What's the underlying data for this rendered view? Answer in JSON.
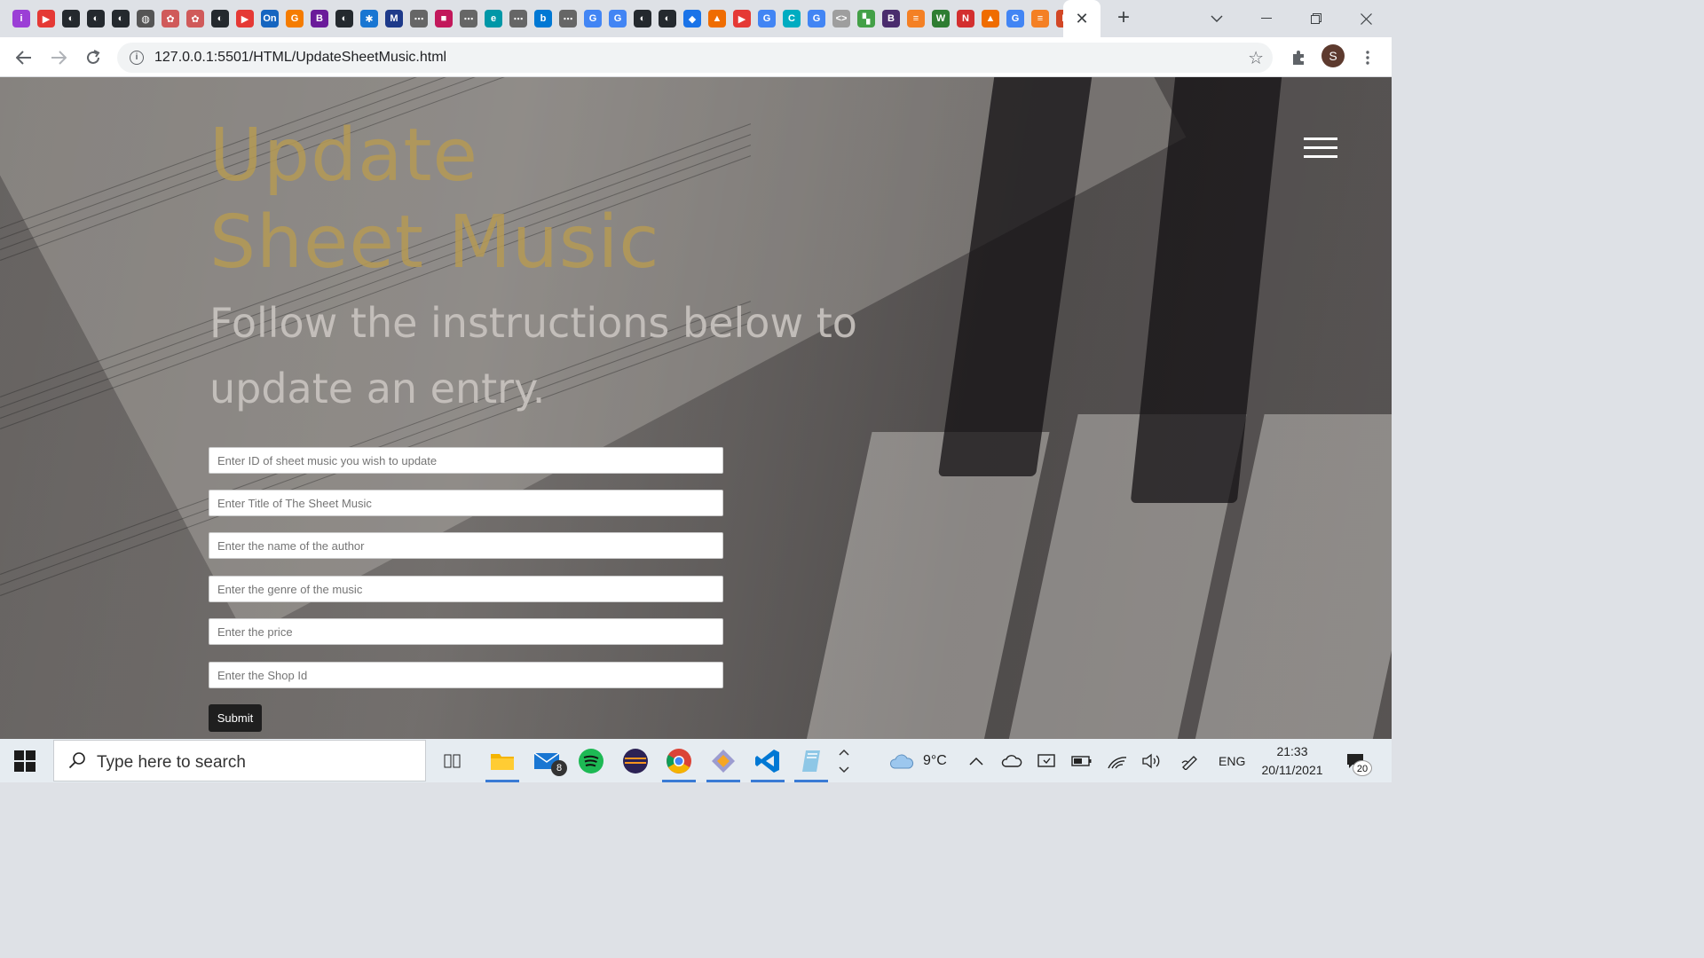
{
  "browser": {
    "url": "127.0.0.1:5501/HTML/UpdateSheetMusic.html",
    "active_tab_close": "✕",
    "new_tab": "+",
    "profile_initial": "S",
    "favicons": [
      {
        "name": "favicon-instagram-icon",
        "color": "#9b3fd6",
        "glyph": "i"
      },
      {
        "name": "favicon-youtube-icon",
        "color": "#e53935",
        "glyph": "▶"
      },
      {
        "name": "favicon-github-icon",
        "color": "#24292e",
        "glyph": "◐"
      },
      {
        "name": "favicon-github-icon",
        "color": "#24292e",
        "glyph": "◐"
      },
      {
        "name": "favicon-github-icon",
        "color": "#24292e",
        "glyph": "◐"
      },
      {
        "name": "favicon-globe-icon",
        "color": "#555",
        "glyph": "◍"
      },
      {
        "name": "favicon-chatgpt-icon",
        "color": "#d05a5a",
        "glyph": "✿"
      },
      {
        "name": "favicon-chatgpt-icon",
        "color": "#d05a5a",
        "glyph": "✿"
      },
      {
        "name": "favicon-github-icon",
        "color": "#24292e",
        "glyph": "◐"
      },
      {
        "name": "favicon-youtube-icon",
        "color": "#e53935",
        "glyph": "▶"
      },
      {
        "name": "favicon-on-icon",
        "color": "#1565c0",
        "glyph": "On"
      },
      {
        "name": "favicon-g-icon",
        "color": "#f57c00",
        "glyph": "G"
      },
      {
        "name": "favicon-b-icon",
        "color": "#6a1b9a",
        "glyph": "B"
      },
      {
        "name": "favicon-github-icon",
        "color": "#24292e",
        "glyph": "◐"
      },
      {
        "name": "favicon-gear-icon",
        "color": "#1976d2",
        "glyph": "✱"
      },
      {
        "name": "favicon-mdn-icon",
        "color": "#1e3a8a",
        "glyph": "M"
      },
      {
        "name": "favicon-dots-icon",
        "color": "#666",
        "glyph": "⋯"
      },
      {
        "name": "favicon-app-icon",
        "color": "#c2185b",
        "glyph": "■"
      },
      {
        "name": "favicon-dots-icon",
        "color": "#666",
        "glyph": "⋯"
      },
      {
        "name": "favicon-edge-icon",
        "color": "#0097a7",
        "glyph": "e"
      },
      {
        "name": "favicon-dots-icon",
        "color": "#666",
        "glyph": "⋯"
      },
      {
        "name": "favicon-bing-icon",
        "color": "#0078d4",
        "glyph": "b"
      },
      {
        "name": "favicon-dots-icon",
        "color": "#666",
        "glyph": "⋯"
      },
      {
        "name": "favicon-google-icon",
        "color": "#4285f4",
        "glyph": "G"
      },
      {
        "name": "favicon-google-icon",
        "color": "#4285f4",
        "glyph": "G"
      },
      {
        "name": "favicon-github-icon",
        "color": "#24292e",
        "glyph": "◐"
      },
      {
        "name": "favicon-github-icon",
        "color": "#24292e",
        "glyph": "◐"
      },
      {
        "name": "favicon-diamond-icon",
        "color": "#1a73e8",
        "glyph": "◆"
      },
      {
        "name": "favicon-shapes-icon",
        "color": "#ef6c00",
        "glyph": "▲"
      },
      {
        "name": "favicon-youtube-icon",
        "color": "#e53935",
        "glyph": "▶"
      },
      {
        "name": "favicon-google-icon",
        "color": "#4285f4",
        "glyph": "G"
      },
      {
        "name": "favicon-c-icon",
        "color": "#00acc1",
        "glyph": "C"
      },
      {
        "name": "favicon-google-icon",
        "color": "#4285f4",
        "glyph": "G"
      },
      {
        "name": "favicon-code-icon",
        "color": "#9e9e9e",
        "glyph": "<>"
      },
      {
        "name": "favicon-colorful-icon",
        "color": "#43a047",
        "glyph": "▚"
      },
      {
        "name": "favicon-bootstrap-icon",
        "color": "#4a2c6d",
        "glyph": "B"
      },
      {
        "name": "favicon-stackoverflow-icon",
        "color": "#f48024",
        "glyph": "≡"
      },
      {
        "name": "favicon-w-icon",
        "color": "#2e7d32",
        "glyph": "W"
      },
      {
        "name": "favicon-netflix-icon",
        "color": "#d32f2f",
        "glyph": "N"
      },
      {
        "name": "favicon-shapes-icon",
        "color": "#ef6c00",
        "glyph": "▲"
      },
      {
        "name": "favicon-google-icon",
        "color": "#4285f4",
        "glyph": "G"
      },
      {
        "name": "favicon-stackoverflow-icon",
        "color": "#f48024",
        "glyph": "≡"
      },
      {
        "name": "favicon-powerpoint-icon",
        "color": "#d24726",
        "glyph": "P"
      }
    ]
  },
  "page": {
    "title_line1": "Update",
    "title_line2": "Sheet Music",
    "subtitle": "Follow the instructions below to update an entry.",
    "fields": {
      "id_placeholder": "Enter ID of sheet music you wish to update",
      "title_placeholder": "Enter Title of The Sheet Music",
      "author_placeholder": "Enter the name of the author",
      "genre_placeholder": "Enter the genre of the music",
      "price_placeholder": "Enter the price",
      "shop_placeholder": "Enter the Shop Id"
    },
    "submit_label": "Submit",
    "accent_color": "#b59a55"
  },
  "taskbar": {
    "search_placeholder": "Type here to search",
    "mail_badge": "8",
    "weather": "9°C",
    "language": "ENG",
    "time": "21:33",
    "date": "20/11/2021",
    "notification_count": "20"
  }
}
